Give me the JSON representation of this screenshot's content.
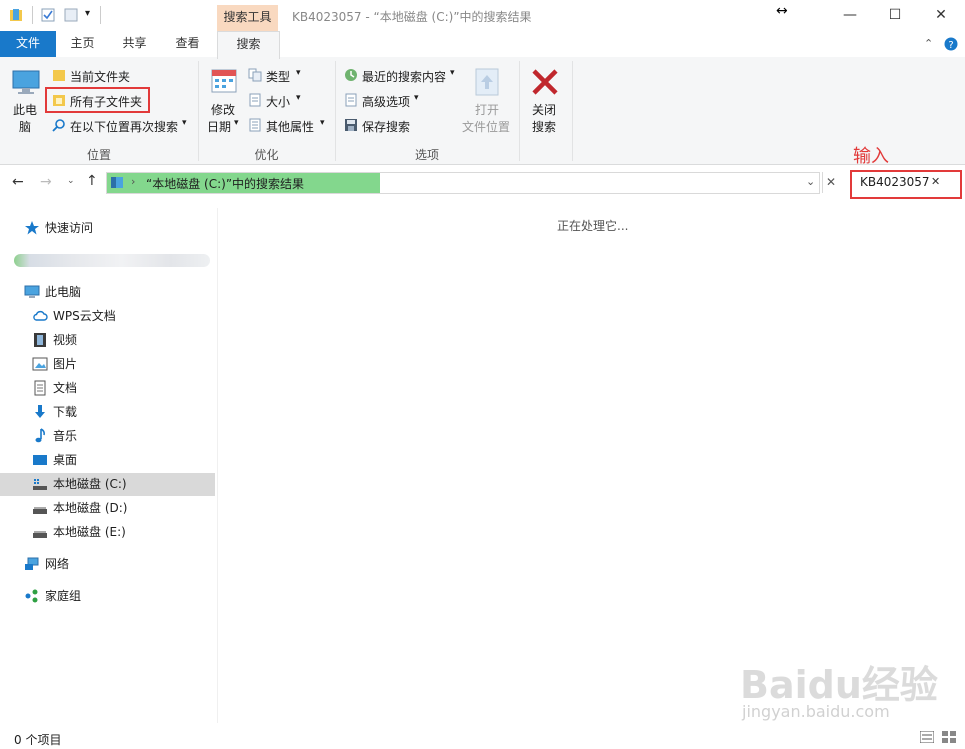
{
  "window": {
    "title": "KB4023057 - “本地磁盘 (C:)”中的搜索结果",
    "context_tab": "搜索工具",
    "controls": {
      "minimize": "—",
      "maximize": "☐",
      "close": "✕"
    },
    "resize_glyph": "↔"
  },
  "ribbon_tabs": [
    "文件",
    "主页",
    "共享",
    "查看",
    "搜索"
  ],
  "ribbon": {
    "location_group": {
      "label": "位置",
      "this_pc": [
        "此电",
        "脑"
      ],
      "current_folder": "当前文件夹",
      "all_subfolders": "所有子文件夹",
      "search_again": "在以下位置再次搜索"
    },
    "refine_group": {
      "label": "优化",
      "date_modified": [
        "修改",
        "日期"
      ],
      "kind": "类型",
      "size": "大小",
      "other_properties": "其他属性"
    },
    "options_group": {
      "label": "选项",
      "recent_searches": "最近的搜索内容",
      "advanced_options": "高级选项",
      "save_search": "保存搜索",
      "open_file_location": [
        "打开",
        "文件位置"
      ],
      "close_search": [
        "关闭",
        "搜索"
      ]
    }
  },
  "annotation": "输入",
  "address_bar": {
    "path": "“本地磁盘 (C:)”中的搜索结果",
    "close": "✕"
  },
  "search_box": {
    "value": "KB4023057",
    "clear": "✕"
  },
  "nav_pane": {
    "quick_access": "快速访问",
    "this_pc": "此电脑",
    "items": [
      "WPS云文档",
      "视频",
      "图片",
      "文档",
      "下载",
      "音乐",
      "桌面",
      "本地磁盘 (C:)",
      "本地磁盘 (D:)",
      "本地磁盘 (E:)"
    ],
    "network": "网络",
    "homegroup": "家庭组"
  },
  "content": {
    "status_message": "正在处理它..."
  },
  "status_bar": {
    "item_count": "0 个项目"
  },
  "watermark": {
    "brand": "Baidu经验",
    "url": "jingyan.baidu.com"
  },
  "colors": {
    "accent": "#1979ca",
    "progress": "#83d78d",
    "highlight": "#e23a3a",
    "context_tab": "#f9d9c0"
  }
}
